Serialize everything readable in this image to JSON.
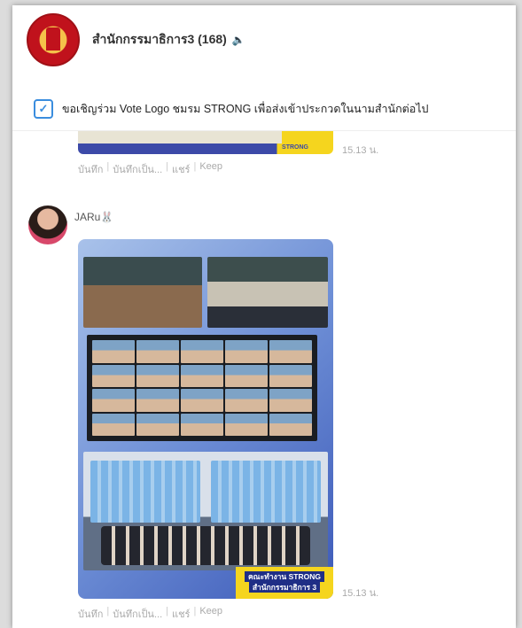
{
  "header": {
    "group_title": "สำนักกรรมาธิการ3 (168)",
    "mute_icon": "speaker-mute-icon"
  },
  "announcement": {
    "icon": "checkbox-icon",
    "text": "ขอเชิญร่วม Vote Logo ชมรม STRONG เพื่อส่งเข้าประกวดในนามสำนักต่อไป"
  },
  "messages": [
    {
      "image_badge": "STRONG",
      "time": "15.13 น.",
      "actions": [
        "บันทึก",
        "บันทึกเป็น...",
        "แชร์",
        "Keep"
      ]
    },
    {
      "sender": "JARu🐰",
      "banner_line1": "คณะทำงาน STRONG",
      "banner_line2": "สำนักกรรมาธิการ 3",
      "time": "15.13 น.",
      "actions": [
        "บันทึก",
        "บันทึกเป็น...",
        "แชร์",
        "Keep"
      ]
    }
  ]
}
